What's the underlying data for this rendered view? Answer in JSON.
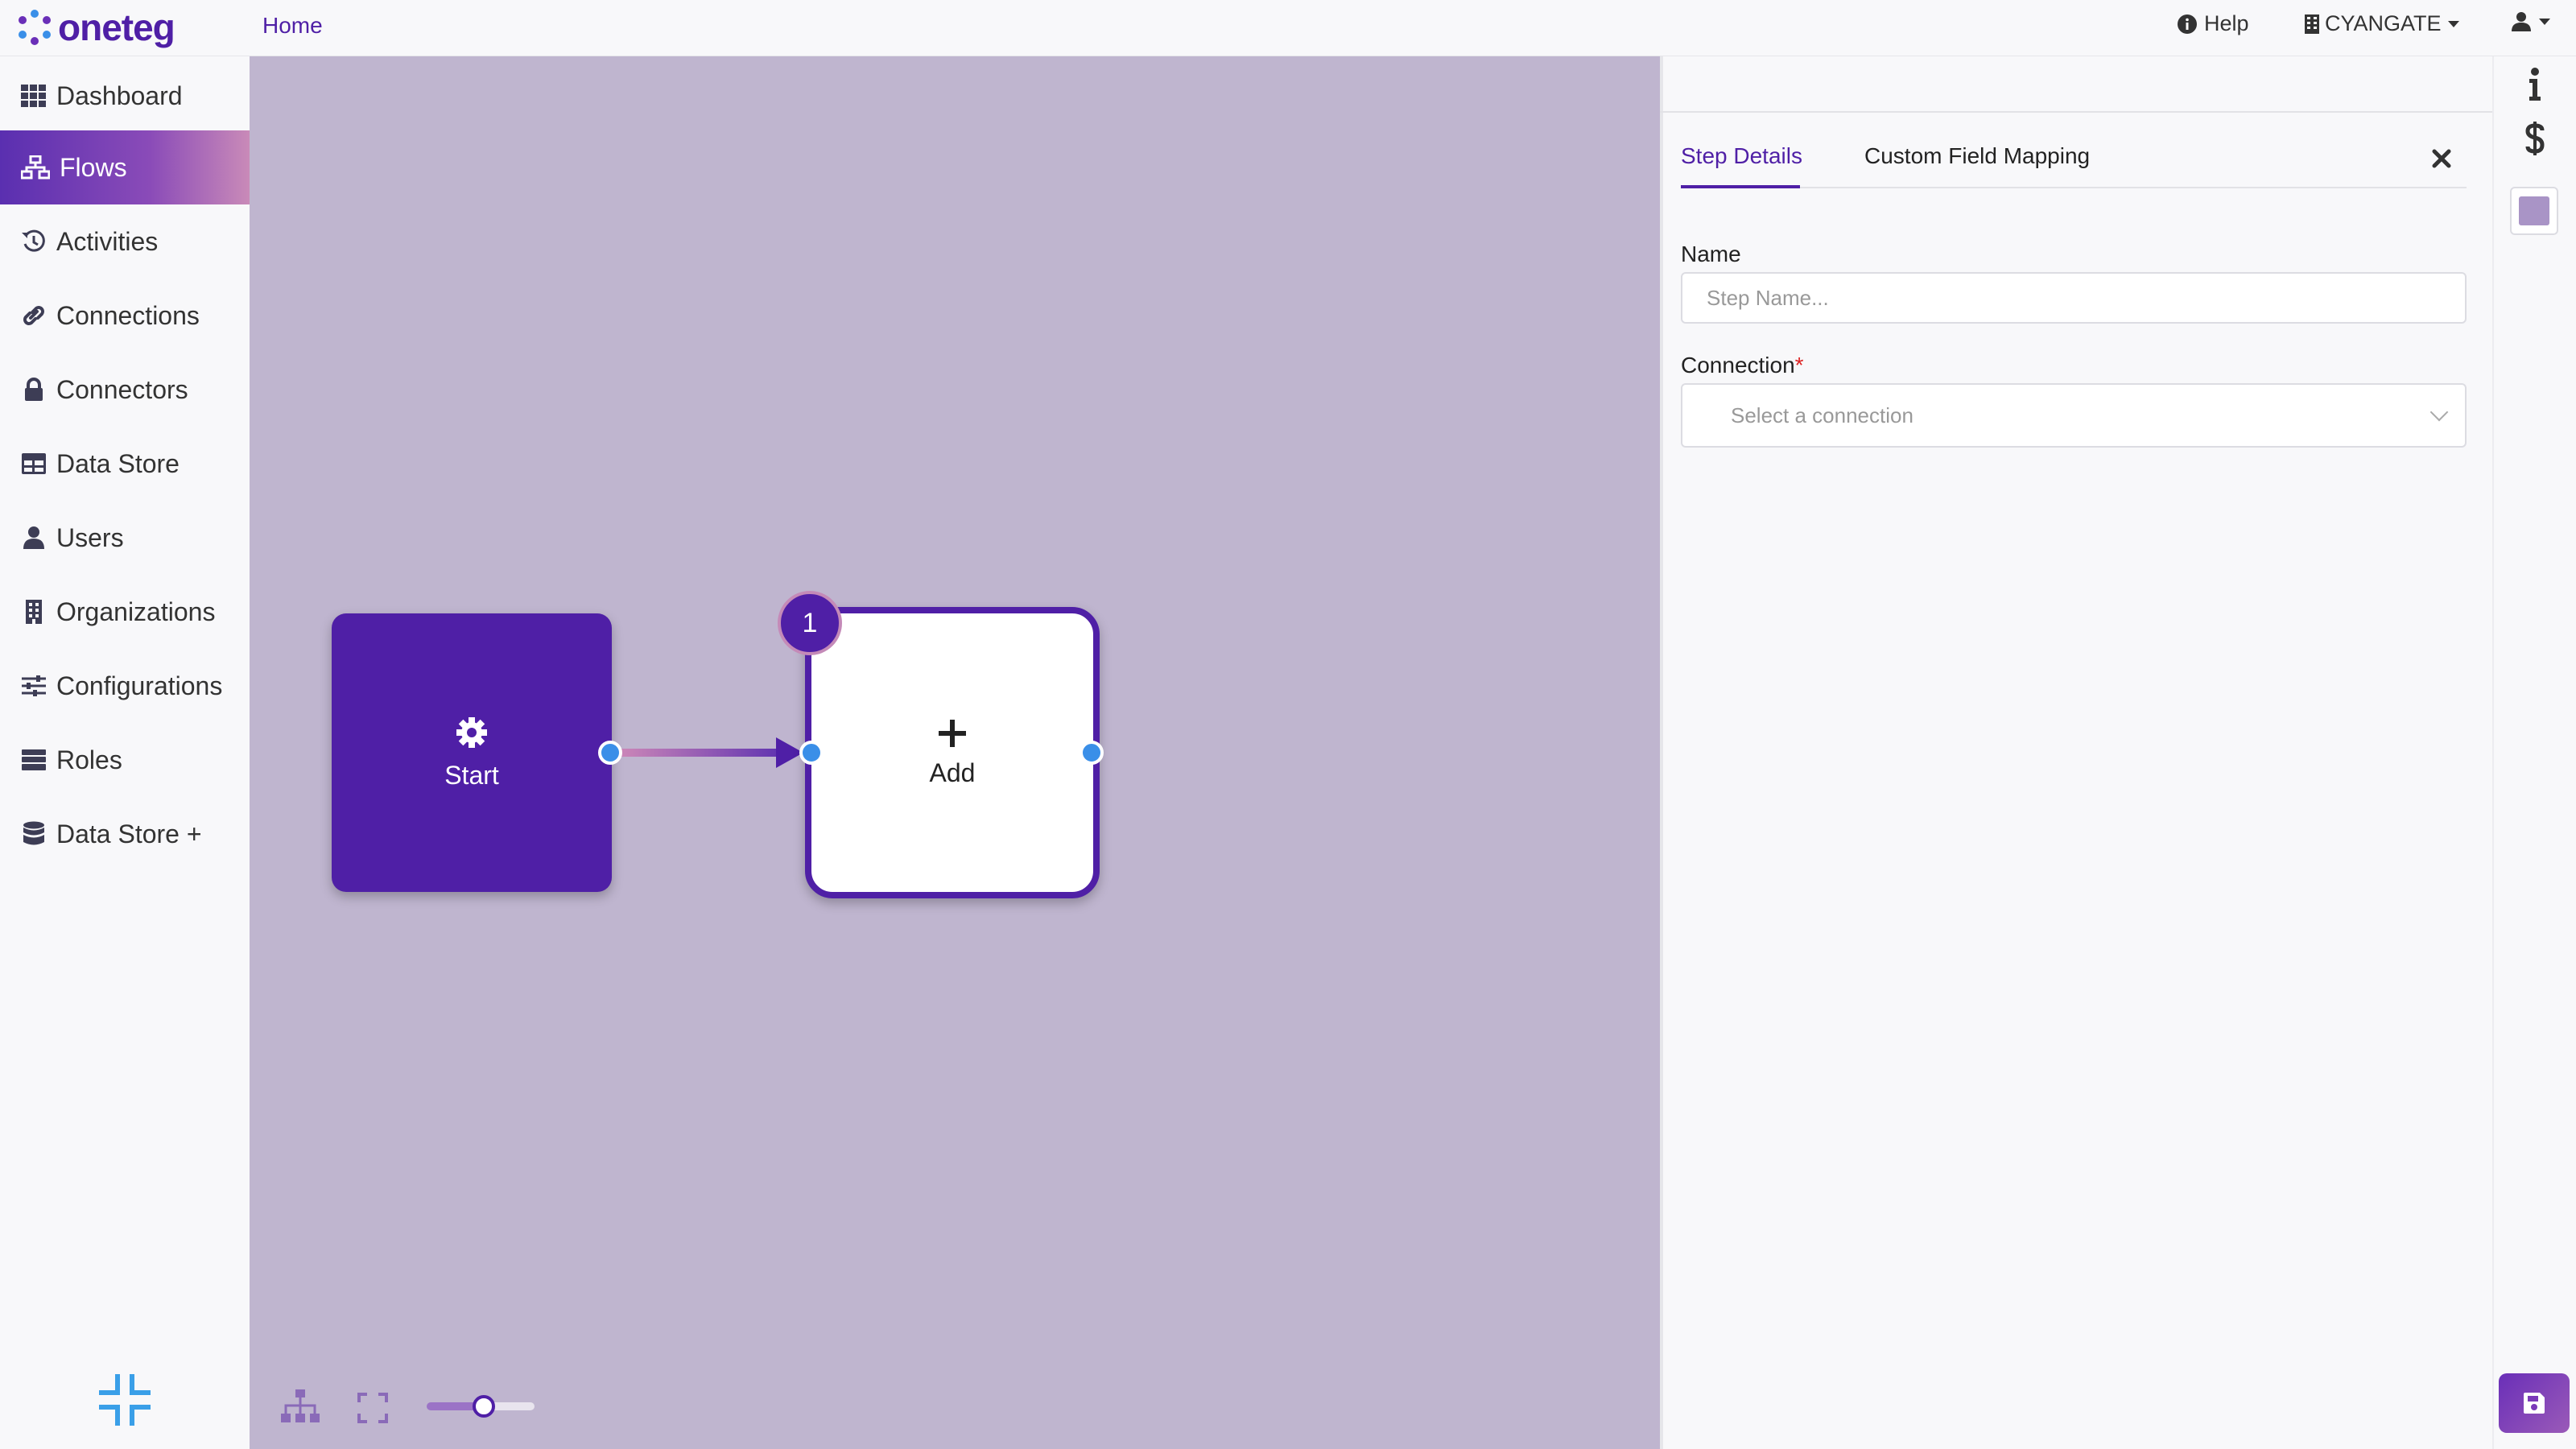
{
  "app": {
    "brand": "oneteg",
    "breadcrumb": "Home"
  },
  "header": {
    "help_label": "Help",
    "org_label": "CYANGATE"
  },
  "sidebar": {
    "items": [
      {
        "label": "Dashboard",
        "icon": "grid-icon"
      },
      {
        "label": "Flows",
        "icon": "sitemap-icon",
        "active": true
      },
      {
        "label": "Activities",
        "icon": "history-icon"
      },
      {
        "label": "Connections",
        "icon": "link-icon"
      },
      {
        "label": "Connectors",
        "icon": "lock-icon"
      },
      {
        "label": "Data Store",
        "icon": "table-icon"
      },
      {
        "label": "Users",
        "icon": "user-icon"
      },
      {
        "label": "Organizations",
        "icon": "building-icon"
      },
      {
        "label": "Configurations",
        "icon": "sliders-icon"
      },
      {
        "label": "Roles",
        "icon": "server-icon"
      },
      {
        "label": "Data Store +",
        "icon": "database-icon"
      }
    ]
  },
  "canvas": {
    "start_node": {
      "label": "Start",
      "icon": "gear-icon"
    },
    "add_node": {
      "label": "Add",
      "badge": "1",
      "icon": "plus-icon"
    },
    "zoom_level": 0.5
  },
  "panel": {
    "tabs": [
      "Step Details",
      "Custom Field Mapping"
    ],
    "active_tab": "Step Details",
    "name_label": "Name",
    "name_placeholder": "Step Name...",
    "connection_label": "Connection",
    "connection_required": "*",
    "connection_placeholder": "Select a connection"
  },
  "colors": {
    "accent": "#4f1fa6",
    "canvas_bg": "#bfb5cf",
    "port": "#3a8fe8",
    "required": "#dd2222"
  }
}
